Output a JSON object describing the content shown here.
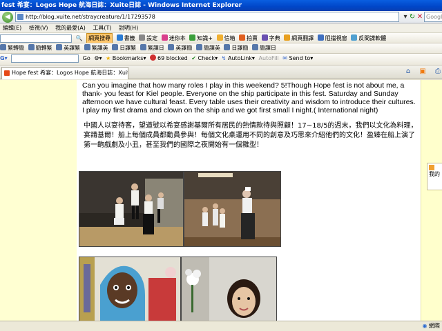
{
  "window": {
    "title": "fest 希宴：Logos Hope 航海日誌：Xuite日誌 - Windows Internet Explorer"
  },
  "address": {
    "url": "http://blog.xuite.net/straycreature/1/17293578",
    "search_placeholder": "Google"
  },
  "menu": {
    "items": [
      "編輯(E)",
      "檢視(V)",
      "我的最愛(A)",
      "工具(T)",
      "說明(H)"
    ]
  },
  "toolbar1": {
    "search_btn": "網頁搜尋",
    "items": [
      "書籤",
      "設定",
      "迷你本",
      "知識+",
      "信箱",
      "拍賣",
      "字典",
      "網頁翻譯",
      "阻擋視窗",
      "反間諜軟體"
    ]
  },
  "toolbar2": {
    "items": [
      "繁轉簡",
      "簡轉繁",
      "英譯繁",
      "繁譯英",
      "日譯繁",
      "繁譯日",
      "英譯簡",
      "簡譯英",
      "日譯簡",
      "簡譯日"
    ]
  },
  "toolbar3": {
    "go": "Go",
    "bookmarks": "Bookmarks",
    "blocked": "69 blocked",
    "check": "Check",
    "autolink": "AutoLink",
    "autofill": "AutoFill",
    "sendto": "Send to"
  },
  "tab": {
    "title": "Hope fest 希宴：Logos Hope 航海日誌：Xuite日誌"
  },
  "post": {
    "para_en": "Can you imagine that how many roles I play in this weekend? 5!Though Hope fest is not about me, a thank- you feast for Kiel people. Everyone on the ship participate in this fest. Saturday and Sunday afternoon we have cultural feast. Every table uses their creativity and wisdom to introduce their cultures. I play my first drama and clown on the ship and we got first small I night.( International night)",
    "para_zh": "中國人以宴待客，望道號以希宴感謝基爾所有居民的熱情款待與照顧！17~18/5的週末，我們以文化為料理，宴請基爾！船上每個成員都動員參與！每個文化桌運用不同的創意及巧思來介紹他們的文化！盈臻在船上演了第一齣戲劇及小丑，甚至我們的國際之夜開始有一個雛型！"
  },
  "right": {
    "label": "我的"
  },
  "status": {
    "zone": "網際"
  },
  "colors": {
    "page_bg": "#ffffd2",
    "title_blue": "#0046c8"
  }
}
